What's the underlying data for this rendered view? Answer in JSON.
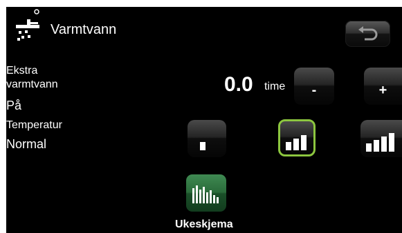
{
  "header": {
    "title": "Varmtvann",
    "icon": "shower-icon",
    "back_icon": "back-arrow-icon"
  },
  "extra_hot_water": {
    "label_line1": "Ekstra",
    "label_line2": "varmtvann",
    "status": "På",
    "value": "0.0",
    "unit": "time",
    "decrease_label": "-",
    "increase_label": "+"
  },
  "temperature": {
    "label": "Temperatur",
    "value": "Normal",
    "levels": [
      "low",
      "normal",
      "high"
    ],
    "selected": "normal"
  },
  "schedule": {
    "label": "Ukeskjema",
    "icon": "weekly-schedule-icon"
  },
  "colors": {
    "background": "#000000",
    "selected_border": "#8cc63f",
    "schedule_button": "#2a6b3a"
  }
}
